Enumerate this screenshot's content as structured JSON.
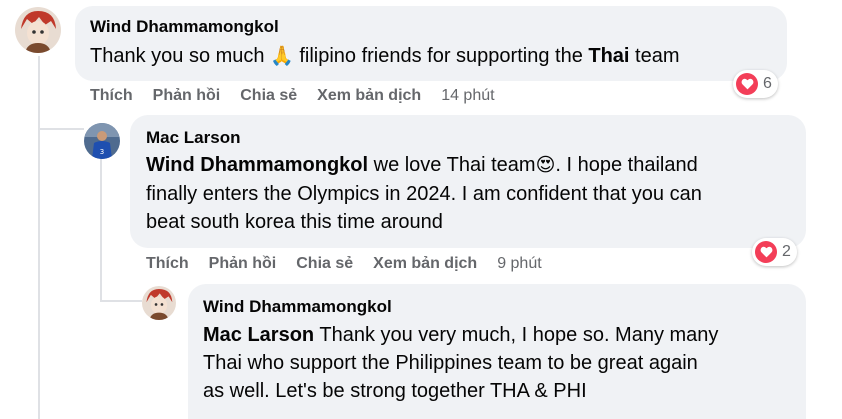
{
  "comment1": {
    "author": "Wind Dhammamongkol",
    "text_before": "Thank you so much ",
    "emoji": "🙏",
    "text_middle": " filipino friends for supporting the ",
    "bold": "Thai",
    "text_after": " team",
    "actions": {
      "like": "Thích",
      "reply": "Phản hồi",
      "share": "Chia sẻ",
      "translate": "Xem bản dịch",
      "time": "14 phút"
    },
    "reaction_count": "6",
    "reaction_icon": "heart-icon"
  },
  "comment2": {
    "author": "Mac Larson",
    "mention": "Wind Dhammamongkol",
    "text_line1": " we love Thai team",
    "emoji": "😍",
    "text_line1b": ". I hope thailand",
    "text_line2": "finally enters the Olympics in 2024. I am confident that you can",
    "text_line3": "beat south korea this time around",
    "actions": {
      "like": "Thích",
      "reply": "Phản hồi",
      "share": "Chia sẻ",
      "translate": "Xem bản dịch",
      "time": "9 phút"
    },
    "reaction_count": "2",
    "reaction_icon": "heart-icon"
  },
  "comment3": {
    "author": "Wind Dhammamongkol",
    "mention": "Mac Larson",
    "text_line1": " Thank you very much, I hope so. Many many",
    "text_line2": "Thai who support the Philippines team to be great again",
    "text_line3": "as well. Let's be strong together THA & PHI"
  },
  "colors": {
    "bubble": "#f0f2f5",
    "heart": "#f33e58",
    "meta": "#65676b"
  }
}
